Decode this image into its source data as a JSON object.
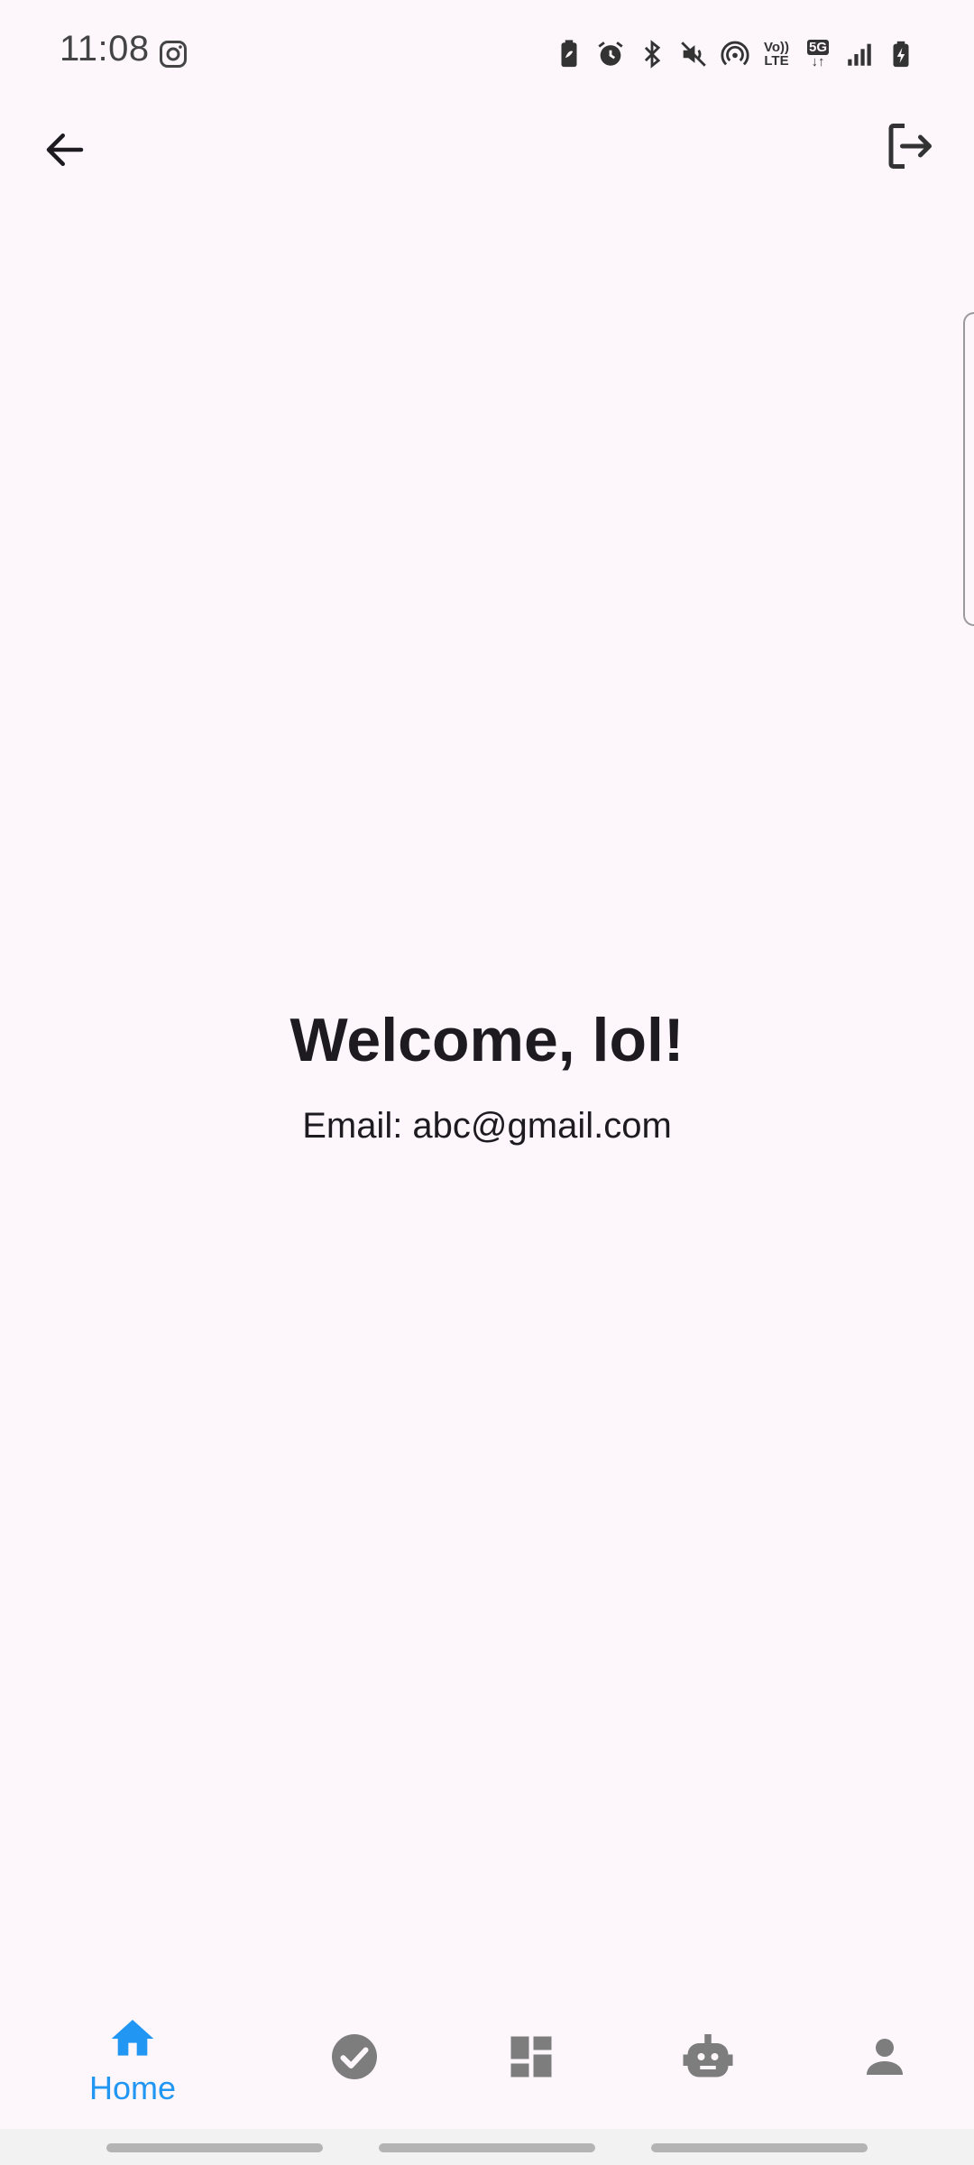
{
  "status_bar": {
    "time": "11:08",
    "left_icon": "instagram-icon",
    "right_icons": [
      "battery-saver-icon",
      "alarm-icon",
      "bluetooth-icon",
      "mute-icon",
      "hotspot-icon",
      "volte-icon",
      "5g-icon",
      "signal-icon",
      "battery-icon"
    ],
    "volte_label_top": "Vo))",
    "volte_label_bottom": "LTE",
    "network_label": "5G"
  },
  "app_bar": {
    "back_icon": "arrow-back-icon",
    "logout_icon": "logout-icon"
  },
  "main": {
    "welcome_title": "Welcome, lol!",
    "email_line": "Email: abc@gmail.com"
  },
  "bottom_nav": {
    "items": [
      {
        "label": "Home",
        "icon": "home-icon",
        "active": true
      },
      {
        "label": "",
        "icon": "check-circle-icon",
        "active": false
      },
      {
        "label": "",
        "icon": "dashboard-icon",
        "active": false
      },
      {
        "label": "",
        "icon": "robot-icon",
        "active": false
      },
      {
        "label": "",
        "icon": "person-icon",
        "active": false
      }
    ],
    "active_color": "#2196f3",
    "inactive_color": "#7d7d7d"
  },
  "colors": {
    "background": "#fdf7fc",
    "text_primary": "#1d1b20"
  }
}
